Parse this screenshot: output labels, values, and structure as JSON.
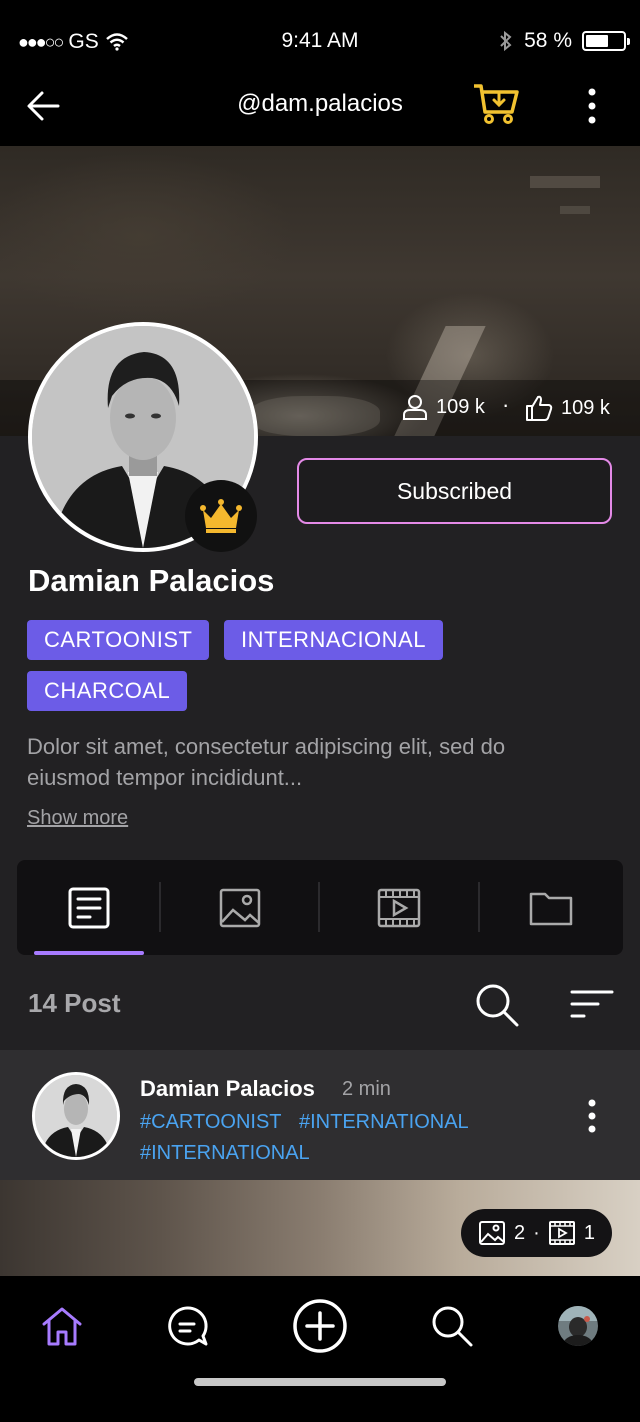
{
  "status_bar": {
    "carrier": "GS",
    "time": "9:41 AM",
    "battery": "58 %"
  },
  "nav": {
    "title": "@dam.palacios"
  },
  "profile": {
    "followers": "109 k",
    "likes": "109 k",
    "subscribe_label": "Subscribed",
    "name": "Damian Palacios",
    "tags": [
      "CARTOONIST",
      "INTERNACIONAL",
      "CHARCOAL"
    ],
    "bio": "Dolor sit amet, consectetur adipiscing elit, sed do eiusmod tempor incididunt...",
    "show_more": "Show more"
  },
  "tabs": {
    "active": "posts",
    "items": [
      "posts",
      "images",
      "videos",
      "folders"
    ]
  },
  "posts_header": {
    "count_label": "14 Post"
  },
  "post": {
    "author": "Damian Palacios",
    "time": "2 min",
    "hashtags": [
      "#CARTOONIST",
      "#INTERNATIONAL",
      "#INTERNATIONAL"
    ],
    "image_count": "2",
    "video_count": "1"
  },
  "colors": {
    "accent": "#6c5ce7",
    "cart": "#f2c230",
    "subscribe_border": "#e48ae7",
    "hashtag": "#4aa3f0",
    "tab_underline": "#a77bff"
  }
}
